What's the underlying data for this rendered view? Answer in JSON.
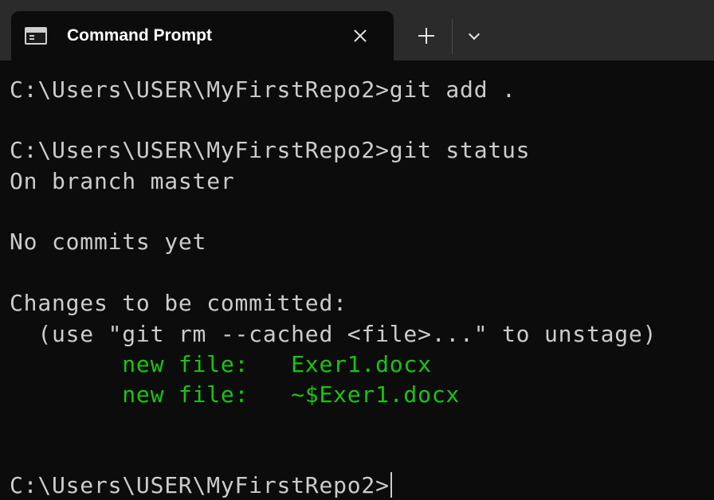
{
  "tab": {
    "title": "Command Prompt",
    "icon": "cmd-icon"
  },
  "toolbar": {
    "close_icon": "close-icon",
    "new_tab_icon": "plus-icon",
    "dropdown_icon": "chevron-down-icon"
  },
  "console": {
    "lines": [
      "C:\\Users\\USER\\MyFirstRepo2>git add .",
      "C:\\Users\\USER\\MyFirstRepo2>git status",
      "On branch master",
      "No commits yet",
      "Changes to be committed:",
      "  (use \"git rm --cached <file>...\" to unstage)",
      "        new file:   Exer1.docx",
      "        new file:   ~$Exer1.docx",
      "C:\\Users\\USER\\MyFirstRepo2>"
    ]
  },
  "colors": {
    "background": "#0c0c0c",
    "tabstrip": "#2b2b2b",
    "text": "#cccccc",
    "staged_file": "#16c60c"
  }
}
